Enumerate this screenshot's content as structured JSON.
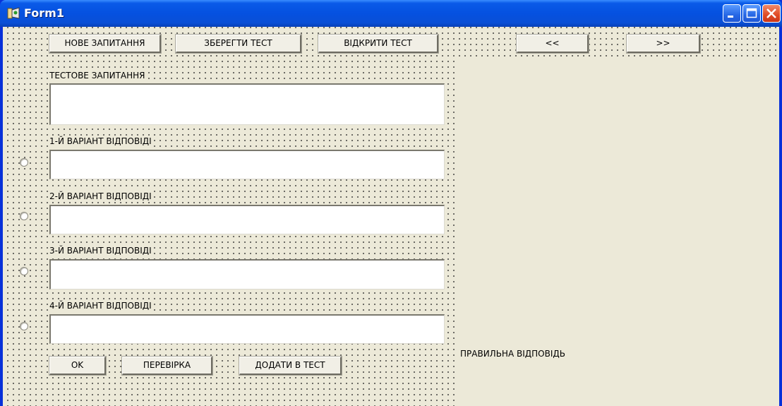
{
  "window": {
    "title": "Form1"
  },
  "toolbar": {
    "new_question": "НОВЕ ЗАПИТАННЯ",
    "save_test": "ЗБЕРЕГТИ ТЕСТ",
    "open_test": "ВІДКРИТИ ТЕСТ",
    "prev": "<<",
    "next": ">>"
  },
  "question": {
    "label": "ТЕСТОВЕ ЗАПИТАННЯ",
    "value": ""
  },
  "answers": [
    {
      "label": "1-Й ВАРІАНТ ВІДПОВІДІ",
      "value": "",
      "selected": false
    },
    {
      "label": "2-Й ВАРІАНТ ВІДПОВІДІ",
      "value": "",
      "selected": false
    },
    {
      "label": "3-Й ВАРІАНТ ВІДПОВІДІ",
      "value": "",
      "selected": false
    },
    {
      "label": "4-Й ВАРІАНТ ВІДПОВІДІ",
      "value": "",
      "selected": false
    }
  ],
  "bottom": {
    "ok": "OK",
    "check": "ПЕРЕВІРКА",
    "add_to_test": "ДОДАТИ В ТЕСТ",
    "correct_answer_label": "ПРАВИЛЬНА ВІДПОВІДЬ"
  },
  "icons": {
    "app": "form-icon",
    "minimize": "minimize-icon",
    "maximize": "maximize-icon",
    "close": "close-icon"
  }
}
